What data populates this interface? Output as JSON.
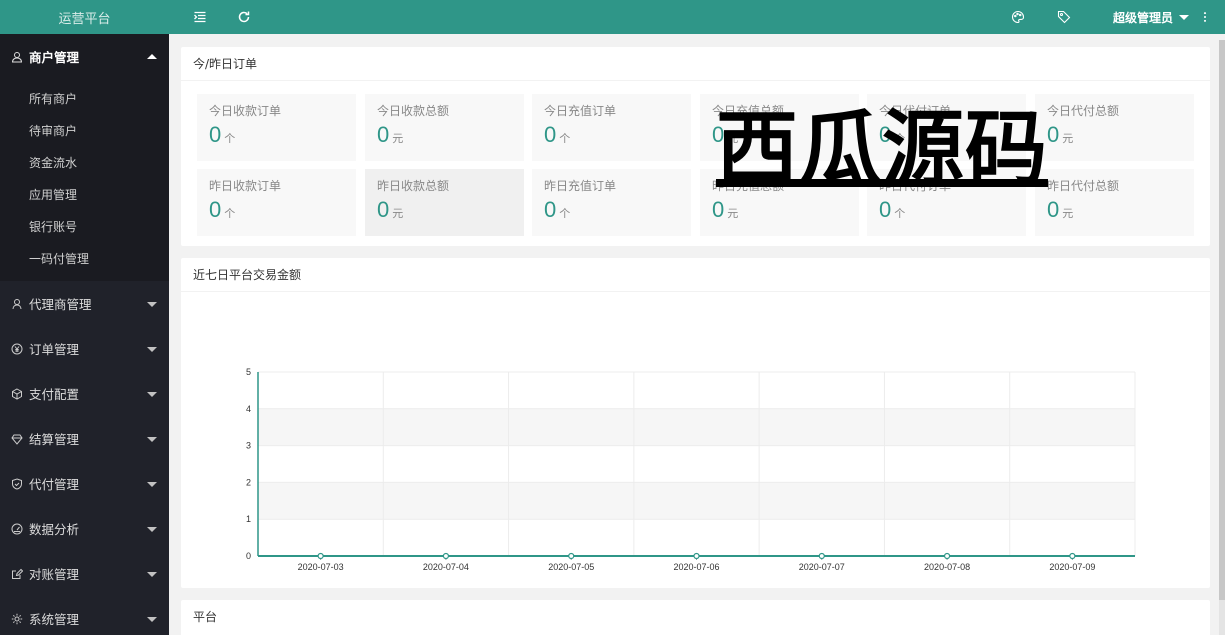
{
  "brand": {
    "title": "运营平台"
  },
  "sidebar": {
    "groups": [
      {
        "label": "商户管理",
        "icon": "merchant-icon",
        "active": true
      },
      {
        "label": "代理商管理",
        "icon": "user-icon"
      },
      {
        "label": "订单管理",
        "icon": "yen-icon"
      },
      {
        "label": "支付配置",
        "icon": "box-icon"
      },
      {
        "label": "结算管理",
        "icon": "diamond-icon"
      },
      {
        "label": "代付管理",
        "icon": "shield-icon"
      },
      {
        "label": "数据分析",
        "icon": "gauge-icon"
      },
      {
        "label": "对账管理",
        "icon": "edit-icon"
      },
      {
        "label": "系统管理",
        "icon": "gear-icon"
      }
    ],
    "sub_items": [
      "所有商户",
      "待审商户",
      "资金流水",
      "应用管理",
      "银行账号",
      "一码付管理"
    ]
  },
  "header": {
    "user": "超级管理员",
    "icons": [
      "menu-fold-icon",
      "refresh-icon",
      "theme-icon",
      "tag-icon",
      "more-icon"
    ]
  },
  "orders_card": {
    "title": "今/昨日订单",
    "stats": [
      {
        "label": "今日收款订单",
        "value": "0",
        "unit": "个"
      },
      {
        "label": "今日收款总额",
        "value": "0",
        "unit": "元"
      },
      {
        "label": "今日充值订单",
        "value": "0",
        "unit": "个"
      },
      {
        "label": "今日充值总额",
        "value": "0",
        "unit": "元"
      },
      {
        "label": "今日代付订单",
        "value": "0",
        "unit": "个"
      },
      {
        "label": "今日代付总额",
        "value": "0",
        "unit": "元"
      },
      {
        "label": "昨日收款订单",
        "value": "0",
        "unit": "个"
      },
      {
        "label": "昨日收款总额",
        "value": "0",
        "unit": "元"
      },
      {
        "label": "昨日充值订单",
        "value": "0",
        "unit": "个"
      },
      {
        "label": "昨日充值总额",
        "value": "0",
        "unit": "元"
      },
      {
        "label": "昨日代付订单",
        "value": "0",
        "unit": "个"
      },
      {
        "label": "昨日代付总额",
        "value": "0",
        "unit": "元"
      }
    ]
  },
  "chart_card": {
    "title": "近七日平台交易金额"
  },
  "platform_card": {
    "title": "平台"
  },
  "watermark": "西瓜源码",
  "colors": {
    "accent": "#2f9688",
    "sidebar": "#20222a"
  },
  "chart_data": {
    "type": "line",
    "categories": [
      "2020-07-03",
      "2020-07-04",
      "2020-07-05",
      "2020-07-06",
      "2020-07-07",
      "2020-07-08",
      "2020-07-09"
    ],
    "values": [
      0,
      0,
      0,
      0,
      0,
      0,
      0
    ],
    "ylim": [
      0,
      5
    ],
    "yticks": [
      0,
      1,
      2,
      3,
      4,
      5
    ],
    "grid": true,
    "color": "#2f9688"
  }
}
